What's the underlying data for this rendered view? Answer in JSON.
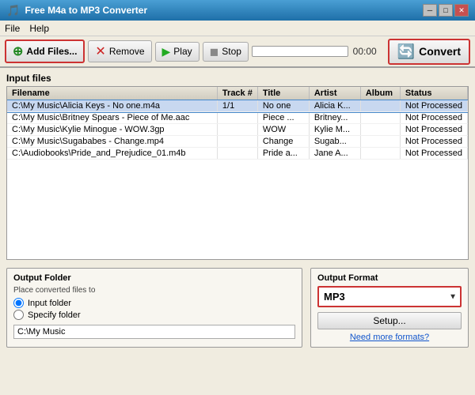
{
  "titleBar": {
    "icon": "🎵",
    "title": "Free M4a to MP3 Converter",
    "controls": {
      "minimize": "─",
      "maximize": "□",
      "close": "✕"
    }
  },
  "menuBar": {
    "items": [
      "File",
      "Help"
    ]
  },
  "toolbar": {
    "addFiles": "Add Files...",
    "remove": "Remove",
    "play": "Play",
    "stop": "Stop",
    "time": "00:00",
    "convert": "Convert"
  },
  "inputFiles": {
    "sectionLabel": "Input files",
    "columns": [
      "Filename",
      "Track #",
      "Title",
      "Artist",
      "Album",
      "Status"
    ],
    "rows": [
      {
        "filename": "C:\\My Music\\Alicia Keys - No one.m4a",
        "track": "1/1",
        "title": "No one",
        "artist": "Alicia K...",
        "album": "",
        "status": "Not Processed",
        "selected": true
      },
      {
        "filename": "C:\\My Music\\Britney Spears - Piece of Me.aac",
        "track": "",
        "title": "Piece ...",
        "artist": "Britney...",
        "album": "",
        "status": "Not Processed",
        "selected": false
      },
      {
        "filename": "C:\\My Music\\Kylie Minogue - WOW.3gp",
        "track": "",
        "title": "WOW",
        "artist": "Kylie M...",
        "album": "",
        "status": "Not Processed",
        "selected": false
      },
      {
        "filename": "C:\\My Music\\Sugababes - Change.mp4",
        "track": "",
        "title": "Change",
        "artist": "Sugab...",
        "album": "",
        "status": "Not Processed",
        "selected": false
      },
      {
        "filename": "C:\\Audiobooks\\Pride_and_Prejudice_01.m4b",
        "track": "",
        "title": "Pride a...",
        "artist": "Jane A...",
        "album": "",
        "status": "Not Processed",
        "selected": false
      }
    ]
  },
  "outputFolder": {
    "title": "Output Folder",
    "subtitle": "Place converted files to",
    "options": [
      "Input folder",
      "Specify folder"
    ],
    "selectedOption": "Input folder",
    "path": "C:\\My Music"
  },
  "outputFormat": {
    "title": "Output Format",
    "format": "MP3",
    "setupLabel": "Setup...",
    "moreFormats": "Need more formats?"
  }
}
